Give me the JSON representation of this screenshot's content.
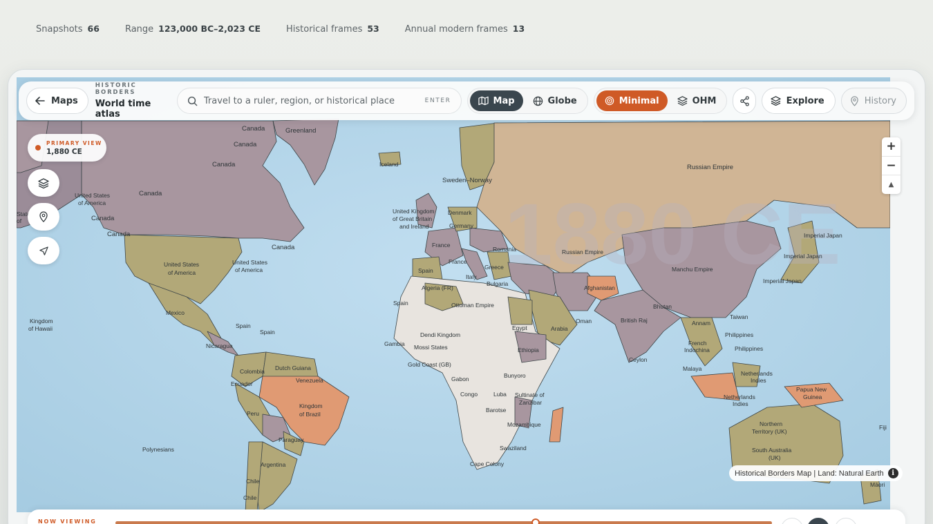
{
  "stats": [
    {
      "label": "Snapshots",
      "value": "66"
    },
    {
      "label": "Range",
      "value": "123,000 BC–2,023 CE"
    },
    {
      "label": "Historical frames",
      "value": "53"
    },
    {
      "label": "Annual modern frames",
      "value": "13"
    }
  ],
  "toolbar": {
    "back_label": "Maps",
    "kicker": "HISTORIC BORDERS",
    "title": "World time atlas",
    "search_placeholder": "Travel to a ruler, region, or historical place",
    "search_hint": "ENTER",
    "view_options": [
      "Map",
      "Globe"
    ],
    "style_options": [
      "Minimal",
      "OHM"
    ],
    "explore_label": "Explore",
    "history_label": "History"
  },
  "primary_view": {
    "kicker": "PRIMARY VIEW",
    "year": "1,880 CE"
  },
  "map": {
    "watermark_year": "1880 CE",
    "accent_color": "#cf5a26",
    "labels": {
      "greenland": "Greenland",
      "canada_top1": "Canada",
      "canada_top2": "Canada",
      "canada_top3": "Canada",
      "canada_main": "Canada",
      "canada_w": "Canada",
      "canada_e": "Canada",
      "canada_pac": "Canada",
      "usa_nw_1": "United States",
      "usa_nw_2": "of America",
      "usa_1": "United States",
      "usa_2": "of America",
      "usa_e_1": "United States",
      "usa_e_2": "of America",
      "state_1": "State",
      "state_2": "of",
      "iceland": "Iceland",
      "sweden_norway": "Sweden–Norway",
      "uk_1": "United Kingdom",
      "uk_2": "of Great Britain",
      "uk_3": "and Ireland",
      "denmark": "Denmark",
      "germany": "Germany",
      "france": "France",
      "france2": "France",
      "spain": "Spain",
      "spain2": "Spain",
      "spain3": "Spain",
      "spain4": "Spain",
      "italy": "Italy",
      "romania": "Romania",
      "greece": "Greece",
      "bulgaria": "Bulgaria",
      "algeria": "Algeria (FR)",
      "ottoman": "Ottoman Empire",
      "russian_empire": "Russian Empire",
      "russian_empire2": "Russian Empire",
      "manchu": "Manchu Empire",
      "imperial_japan": "Imperial Japan",
      "imperial_japan2": "Imperial Japan",
      "imperial_japan3": "Imperial Japan",
      "afghanistan": "Afghanistan",
      "bhutan": "Bhutan",
      "british_raj": "British Raj",
      "arabia": "Arabia",
      "oman": "Oman",
      "egypt": "Egypt",
      "ethiopia": "Ethiopia",
      "ceylon": "Ceylon",
      "annam": "Annam",
      "taiwan": "Taiwan",
      "french_indochina_1": "French",
      "french_indochina_2": "Indochina",
      "philippines": "Philippines",
      "philippines2": "Philippines",
      "malaya": "Malaya",
      "netherlands_indies_1": "Netherlands",
      "netherlands_indies_2": "Indies",
      "netherlands_indies2_1": "Netherlands",
      "netherlands_indies2_2": "Indies",
      "papua_1": "Papua New",
      "papua_2": "Guinea",
      "nt_1": "Northern",
      "nt_2": "Territory (UK)",
      "sa_1": "South Australia",
      "sa_2": "(UK)",
      "fiji": "Fiji",
      "maori": "Māori",
      "hawaii_1": "Kingdom",
      "hawaii_2": "of Hawaii",
      "mexico": "Mexico",
      "nicaragua": "Nicaragua",
      "colombia": "Colombia",
      "dutch_guiana": "Dutch Guiana",
      "venezuela": "Venezuela",
      "ecuador": "Ecuador",
      "peru": "Peru",
      "brazil_1": "Kingdom",
      "brazil_2": "of Brazil",
      "paraguay": "Paraguay",
      "argentina": "Argentina",
      "chile": "Chile",
      "chile2": "Chile",
      "polynesians": "Polynesians",
      "dendi": "Dendi Kingdom",
      "mossi": "Mossi States",
      "gold_coast": "Gold Coast (GB)",
      "gambia": "Gambia",
      "gabon": "Gabon",
      "congo": "Congo",
      "luba": "Luba",
      "bunyoro": "Bunyoro",
      "zanzibar_1": "Sultinate of",
      "zanzibar_2": "Zanzibar",
      "barotse": "Barotse",
      "mozambique": "Mozambique",
      "swaziland": "Swaziland",
      "cape": "Cape Colony"
    },
    "attribution": "Historical Borders Map | Land: Natural Earth",
    "zoom_in": "+",
    "zoom_out": "−",
    "compass": "▲"
  },
  "bottom_bar": {
    "kicker": "NOW VIEWING",
    "timeline_progress": 0.64
  }
}
